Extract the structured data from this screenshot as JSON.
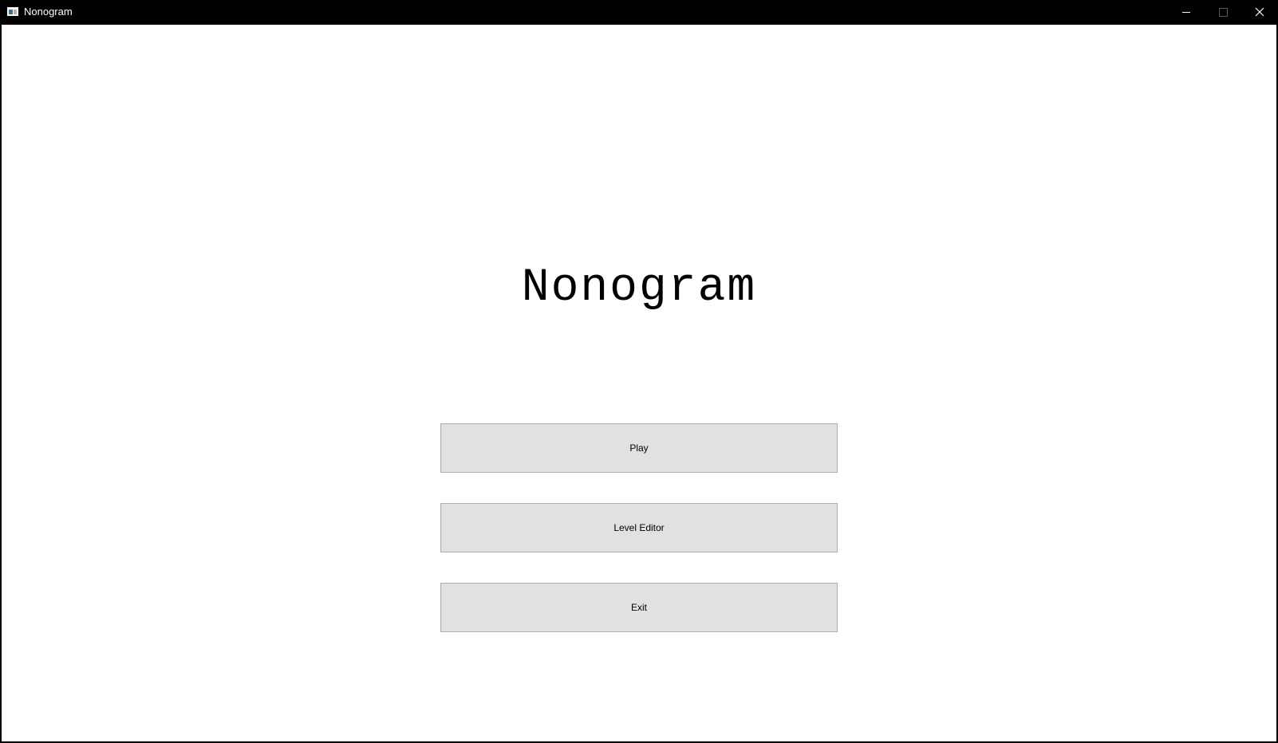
{
  "window": {
    "title": "Nonogram",
    "icon": "app-window-icon",
    "controls": {
      "minimize_icon": "minimize-icon",
      "maximize_icon": "maximize-icon",
      "close_icon": "close-icon"
    }
  },
  "main": {
    "title": "Nonogram",
    "buttons": {
      "play": "Play",
      "level_editor": "Level Editor",
      "exit": "Exit"
    }
  },
  "colors": {
    "titlebar_bg": "#000000",
    "client_bg": "#ffffff",
    "button_bg": "#e1e1e1",
    "button_border": "#adadad"
  }
}
